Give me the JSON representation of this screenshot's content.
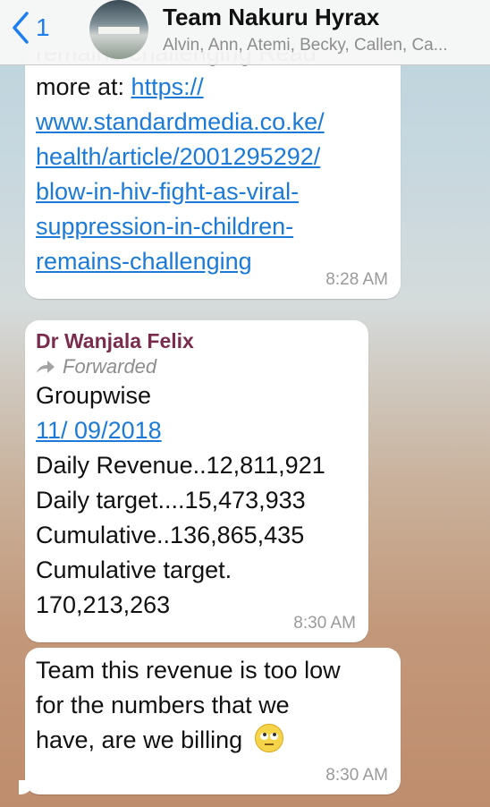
{
  "header": {
    "back_count": "1",
    "title": "Team Nakuru Hyrax",
    "members": "Alvin, Ann, Atemi, Becky, Callen, Ca..."
  },
  "messages": [
    {
      "cut_text": "remains-challenging Read",
      "text": "more at: ",
      "link_lines": [
        "https://",
        "www.standardmedia.co.ke/",
        "health/article/2001295292/",
        "blow-in-hiv-fight-as-viral-",
        "suppression-in-children-",
        "remains-challenging"
      ],
      "time": "8:28 AM"
    },
    {
      "sender": "Dr Wanjala Felix",
      "forwarded": "Forwarded",
      "lines": [
        "Groupwise"
      ],
      "date_link": "11/ 09/2018",
      "stats": [
        "Daily Revenue..12,811,921",
        "Daily target....15,473,933",
        "Cumulative..136,865,435",
        "Cumulative target.",
        "170,213,263"
      ],
      "time": "8:30 AM"
    },
    {
      "lines": [
        "Team this revenue is too low",
        "for the numbers that we",
        "have, are we billing"
      ],
      "emoji": "face-with-rolling-eyes",
      "time": "8:30 AM"
    }
  ]
}
